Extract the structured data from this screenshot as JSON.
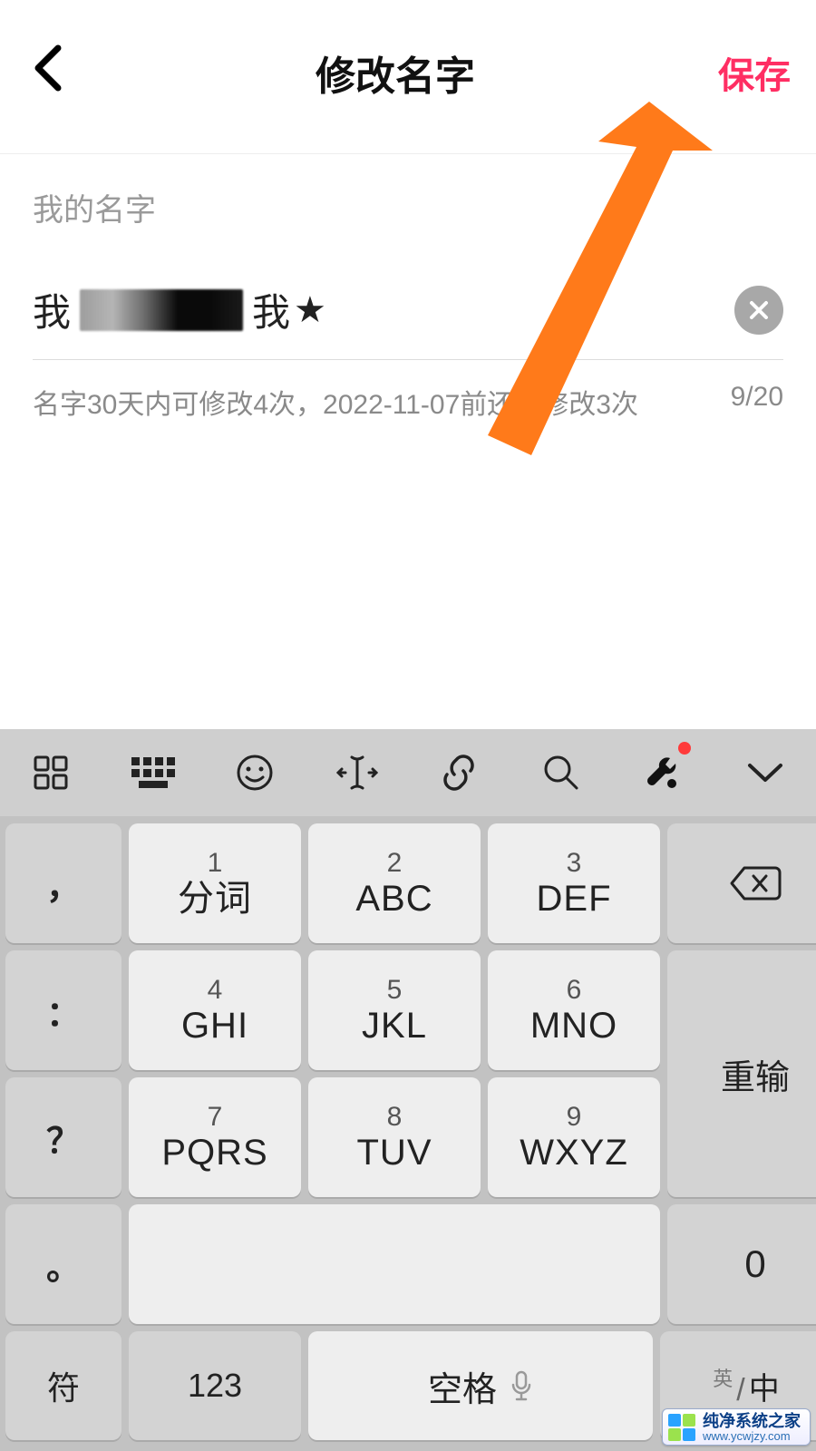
{
  "header": {
    "title": "修改名字",
    "save": "保存"
  },
  "form": {
    "label": "我的名字",
    "value_prefix": "我",
    "value_suffix": "我",
    "star": "★",
    "hint": "名字30天内可修改4次，2022-11-07前还可修改3次",
    "counter": "9/20"
  },
  "keyboard": {
    "side": {
      "comma": "，",
      "colon": "：",
      "question": "？",
      "dot": "。"
    },
    "keys": {
      "k1": {
        "num": "1",
        "label": "分词"
      },
      "k2": {
        "num": "2",
        "label": "ABC"
      },
      "k3": {
        "num": "3",
        "label": "DEF"
      },
      "k4": {
        "num": "4",
        "label": "GHI"
      },
      "k5": {
        "num": "5",
        "label": "JKL"
      },
      "k6": {
        "num": "6",
        "label": "MNO"
      },
      "k7": {
        "num": "7",
        "label": "PQRS"
      },
      "k8": {
        "num": "8",
        "label": "TUV"
      },
      "k9": {
        "num": "9",
        "label": "WXYZ"
      },
      "k0": {
        "label": "0"
      }
    },
    "right": {
      "reinput": "重输"
    },
    "bottom": {
      "symbol": "符",
      "num": "123",
      "space": "空格",
      "lang_sup": "英",
      "lang_main": "中",
      "lang_slash": "/"
    }
  },
  "watermark": {
    "cn": "纯净系统之家",
    "url": "www.ycwjzy.com"
  }
}
